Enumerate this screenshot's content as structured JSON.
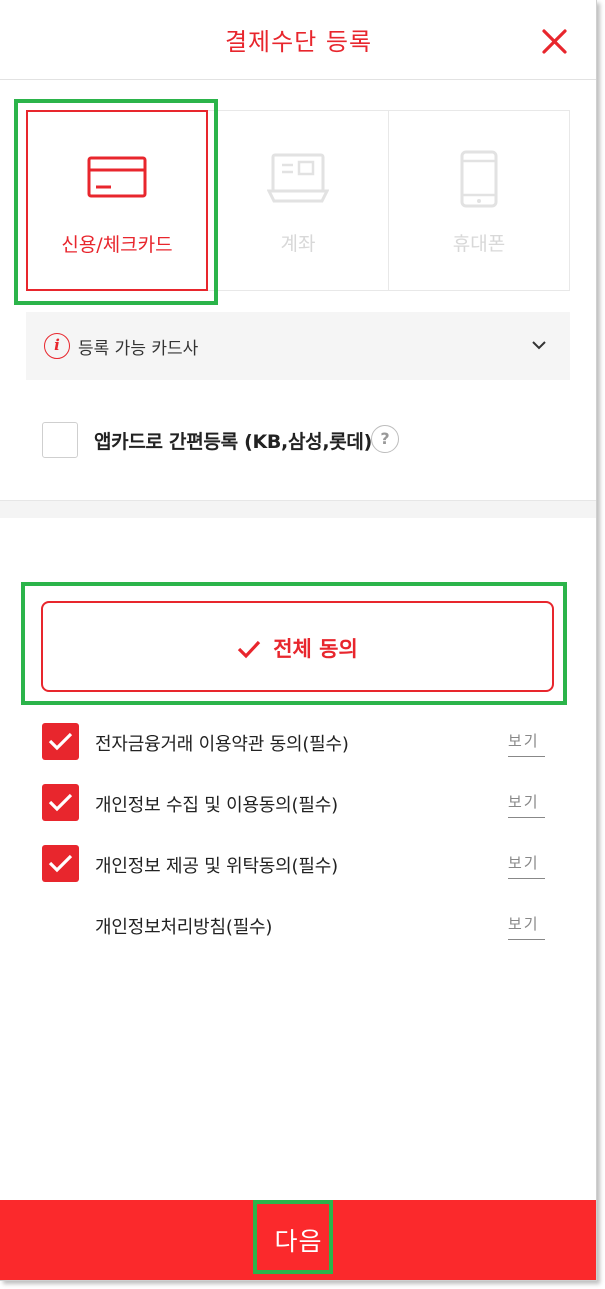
{
  "header": {
    "title": "결제수단 등록",
    "close_icon": "close-icon"
  },
  "payment_methods": [
    {
      "label": "신용/체크카드",
      "icon": "credit-card-icon",
      "selected": true
    },
    {
      "label": "계좌",
      "icon": "bank-account-icon",
      "selected": false
    },
    {
      "label": "휴대폰",
      "icon": "mobile-phone-icon",
      "selected": false
    }
  ],
  "card_info": {
    "label": "등록 가능 카드사",
    "icon": "info-icon",
    "toggle_icon": "chevron-down-icon"
  },
  "app_card": {
    "label": "앱카드로 간편등록 (KB,삼성,롯데)",
    "checked": false,
    "help_icon": "question-icon",
    "help_glyph": "?"
  },
  "agree_all": {
    "label": "전체 동의",
    "icon": "check-icon"
  },
  "terms": [
    {
      "label": "전자금융거래 이용약관 동의(필수)",
      "checked": true,
      "view_label": "보기"
    },
    {
      "label": "개인정보 수집 및 이용동의(필수)",
      "checked": true,
      "view_label": "보기"
    },
    {
      "label": "개인정보 제공 및 위탁동의(필수)",
      "checked": true,
      "view_label": "보기"
    },
    {
      "label": "개인정보처리방침(필수)",
      "checked": false,
      "view_label": "보기"
    }
  ],
  "next_button": {
    "label": "다음"
  },
  "colors": {
    "accent": "#e8262d",
    "next_button_bg": "#fb292c",
    "highlight_box": "#2bb44a",
    "disabled": "#d8d8d8"
  }
}
